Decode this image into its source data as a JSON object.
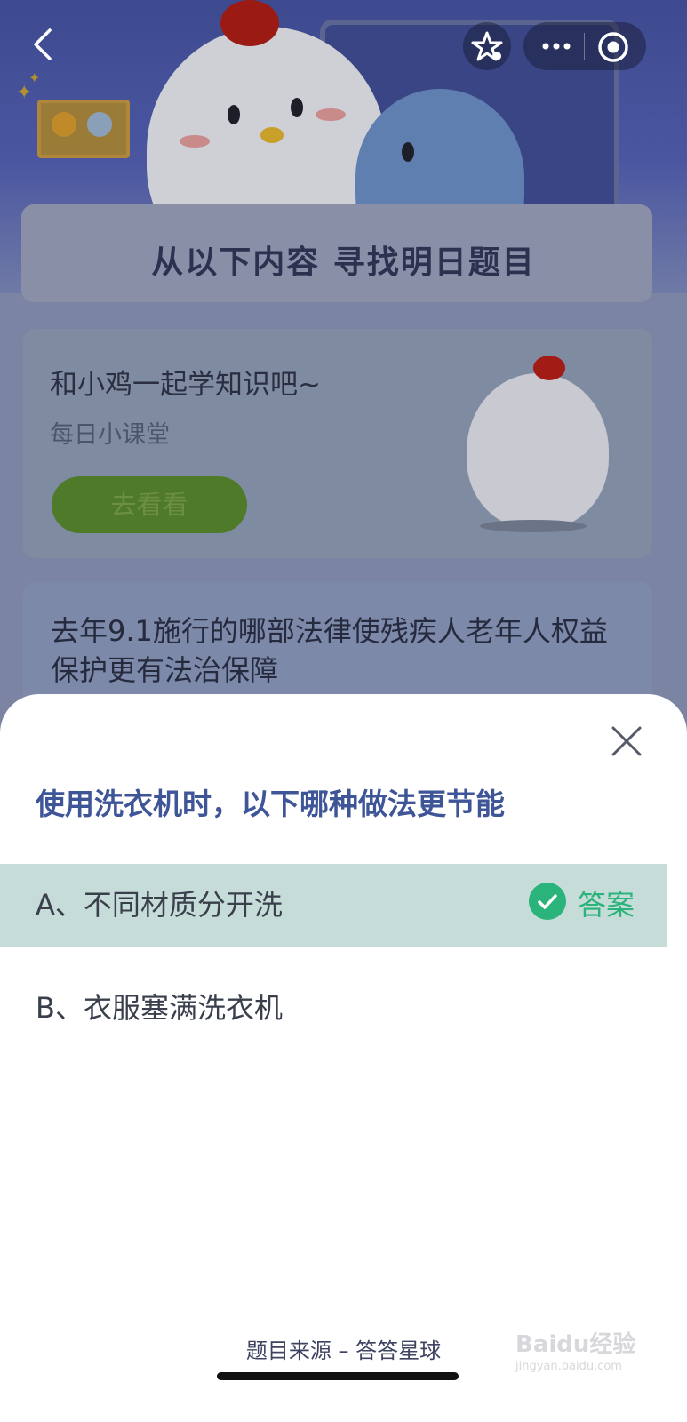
{
  "nav": {
    "back_icon": "chevron-left-icon",
    "favorite_icon": "star-icon",
    "more_icon": "more-dots-icon",
    "close_app_icon": "target-icon"
  },
  "background": {
    "banner_title": "从以下内容  寻找明日题目",
    "learn_card": {
      "title": "和小鸡一起学知识吧~",
      "subtitle": "每日小课堂",
      "button_label": "去看看"
    },
    "question_card": {
      "text": "去年9.1施行的哪部法律使残疾人老年人权益保护更有法治保障"
    }
  },
  "sheet": {
    "close_icon": "close-icon",
    "question": "使用洗衣机时，以下哪种做法更节能",
    "options": [
      {
        "label": "A、不同材质分开洗",
        "correct": true,
        "answer_tag": "答案"
      },
      {
        "label": "B、衣服塞满洗衣机",
        "correct": false
      }
    ],
    "source": "题目来源 – 答答星球"
  },
  "watermark": {
    "text": "Baidu经验",
    "sub": "jingyan.baidu.com"
  },
  "colors": {
    "accent_blue": "#3e5597",
    "correct_green": "#2ab37a",
    "selected_row": "#c6dcd9"
  }
}
